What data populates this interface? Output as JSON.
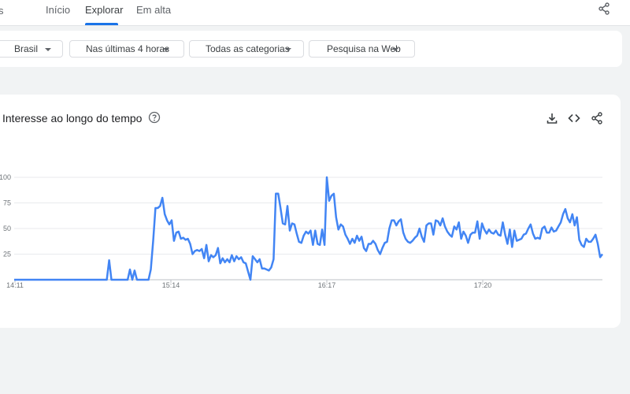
{
  "nav": {
    "edge_glyph": "s",
    "tabs": [
      {
        "label": "Início",
        "active": false
      },
      {
        "label": "Explorar",
        "active": true
      },
      {
        "label": "Em alta",
        "active": false
      }
    ],
    "accent_color": "#1a73e8"
  },
  "filters": {
    "region": "Brasil",
    "time_range": "Nas últimas 4 horas",
    "category": "Todas as categorias",
    "search_type": "Pesquisa na Web"
  },
  "chart_section": {
    "title": "Interesse ao longo do tempo",
    "icons": [
      "help-icon",
      "download-icon",
      "embed-code-icon",
      "share-icon"
    ]
  },
  "chart_data": {
    "type": "line",
    "title": "Interesse ao longo do tempo",
    "x_tick_labels": [
      "14:11",
      "15:14",
      "16:17",
      "17:20"
    ],
    "y_tick_labels": [
      "25",
      "50",
      "75",
      "100"
    ],
    "ylim": [
      0,
      100
    ],
    "grid": true,
    "line_color": "#4285f4",
    "values": [
      0,
      0,
      0,
      0,
      0,
      0,
      0,
      0,
      0,
      0,
      0,
      0,
      0,
      0,
      0,
      0,
      0,
      0,
      0,
      0,
      0,
      0,
      0,
      0,
      0,
      0,
      0,
      0,
      0,
      0,
      0,
      0,
      0,
      0,
      0,
      0,
      0,
      0,
      0,
      0,
      0,
      19,
      0,
      0,
      0,
      0,
      0,
      0,
      0,
      0,
      10,
      0,
      9,
      0,
      0,
      0,
      0,
      0,
      0,
      10,
      38,
      70,
      70,
      72,
      80,
      64,
      58,
      54,
      58,
      38,
      46,
      47,
      40,
      41,
      39,
      40,
      35,
      25,
      28,
      29,
      28,
      30,
      21,
      34,
      18,
      24,
      22,
      24,
      31,
      16,
      21,
      17,
      20,
      17,
      24,
      18,
      23,
      20,
      22,
      17,
      16,
      8,
      0,
      23,
      20,
      17,
      20,
      11,
      11,
      10,
      9,
      12,
      20,
      84,
      84,
      70,
      55,
      54,
      72,
      48,
      55,
      54,
      45,
      37,
      36,
      43,
      47,
      45,
      48,
      34,
      48,
      35,
      34,
      49,
      34,
      100,
      77,
      82,
      84,
      61,
      49,
      54,
      52,
      44,
      40,
      35,
      40,
      36,
      43,
      38,
      42,
      31,
      28,
      35,
      35,
      38,
      35,
      29,
      25,
      31,
      36,
      37,
      50,
      58,
      58,
      53,
      57,
      59,
      46,
      40,
      37,
      36,
      38,
      41,
      43,
      50,
      42,
      37,
      53,
      55,
      55,
      44,
      58,
      57,
      53,
      60,
      52,
      47,
      44,
      42,
      52,
      49,
      56,
      40,
      47,
      43,
      36,
      44,
      46,
      46,
      57,
      40,
      55,
      49,
      45,
      49,
      46,
      45,
      48,
      44,
      43,
      56,
      44,
      35,
      49,
      32,
      48,
      38,
      39,
      40,
      44,
      45,
      50,
      54,
      45,
      40,
      41,
      40,
      50,
      52,
      46,
      46,
      51,
      47,
      48,
      52,
      56,
      64,
      69,
      60,
      56,
      64,
      53,
      61,
      39,
      34,
      32,
      40,
      37,
      37,
      40,
      44,
      35,
      22,
      25
    ]
  }
}
